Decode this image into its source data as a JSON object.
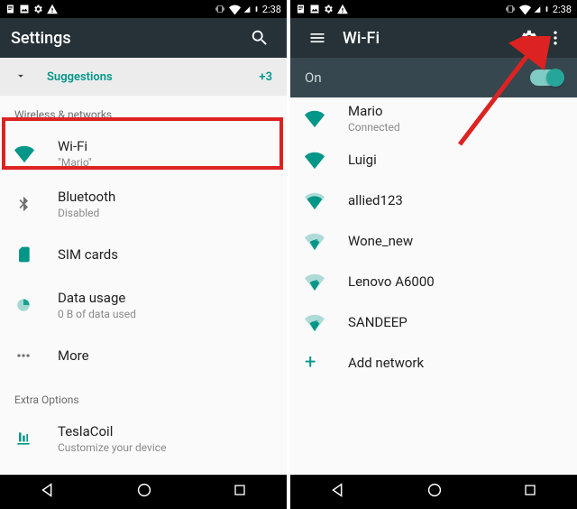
{
  "left": {
    "status": {
      "time": "2:38"
    },
    "appbar": {
      "title": "Settings"
    },
    "suggestions": {
      "label": "Suggestions",
      "count": "+3"
    },
    "section_wireless": "Wireless & networks",
    "wifi": {
      "title": "Wi-Fi",
      "sub": "\"Mario\""
    },
    "bluetooth": {
      "title": "Bluetooth",
      "sub": "Disabled"
    },
    "sim": {
      "title": "SIM cards"
    },
    "data": {
      "title": "Data usage",
      "sub": "0 B of data used"
    },
    "more": {
      "title": "More"
    },
    "section_extra": "Extra Options",
    "teslacoil": {
      "title": "TeslaCoil",
      "sub": "Customize your device"
    }
  },
  "right": {
    "status": {
      "time": "2:38"
    },
    "appbar": {
      "title": "Wi-Fi"
    },
    "subbar": {
      "label": "On"
    },
    "networks": {
      "n0": {
        "name": "Mario",
        "sub": "Connected"
      },
      "n1": {
        "name": "Luigi"
      },
      "n2": {
        "name": "allied123"
      },
      "n3": {
        "name": "Wone_new"
      },
      "n4": {
        "name": "Lenovo A6000"
      },
      "n5": {
        "name": "SANDEEP"
      },
      "add": {
        "label": "Add network"
      }
    }
  }
}
